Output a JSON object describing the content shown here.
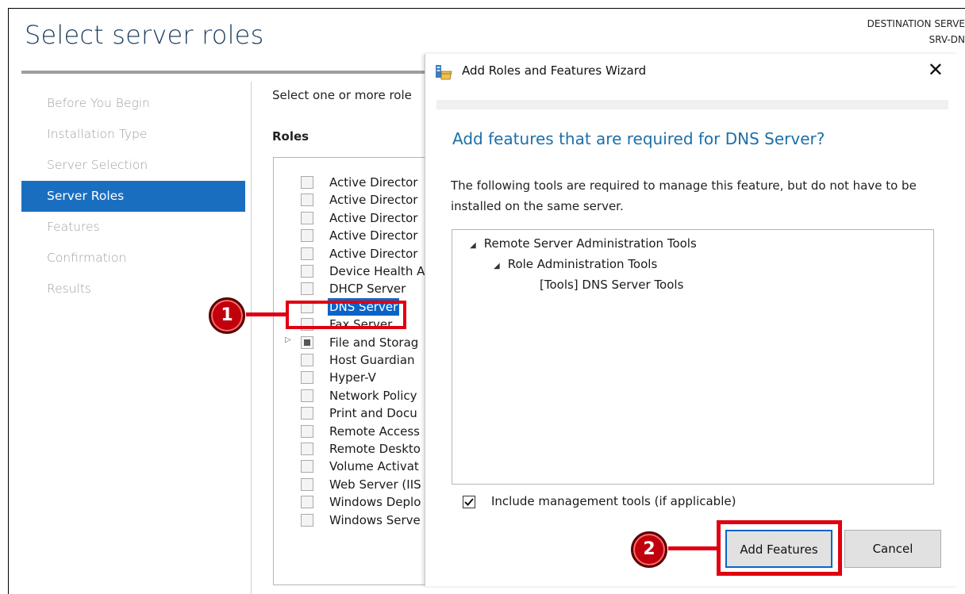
{
  "page": {
    "title": "Select server roles",
    "destination_label": "DESTINATION SERVE",
    "destination_name": "SRV-DN"
  },
  "nav": {
    "items": [
      {
        "label": "Before You Begin",
        "active": false
      },
      {
        "label": "Installation Type",
        "active": false
      },
      {
        "label": "Server Selection",
        "active": false
      },
      {
        "label": "Server Roles",
        "active": true
      },
      {
        "label": "Features",
        "active": false
      },
      {
        "label": "Confirmation",
        "active": false
      },
      {
        "label": "Results",
        "active": false
      }
    ]
  },
  "roles": {
    "intro": "Select one or more role",
    "heading": "Roles",
    "items": [
      {
        "label": "Active Director",
        "state": "unchecked",
        "expandable": false
      },
      {
        "label": "Active Director",
        "state": "unchecked",
        "expandable": false
      },
      {
        "label": "Active Director",
        "state": "unchecked",
        "expandable": false
      },
      {
        "label": "Active Director",
        "state": "unchecked",
        "expandable": false
      },
      {
        "label": "Active Director",
        "state": "unchecked",
        "expandable": false
      },
      {
        "label": "Device Health A",
        "state": "unchecked",
        "expandable": false
      },
      {
        "label": "DHCP Server",
        "state": "unchecked",
        "expandable": false
      },
      {
        "label": "DNS Server",
        "state": "unchecked",
        "expandable": false,
        "selected": true
      },
      {
        "label": "Fax Server",
        "state": "unchecked",
        "expandable": false
      },
      {
        "label": "File and Storag",
        "state": "partial",
        "expandable": true
      },
      {
        "label": "Host Guardian",
        "state": "unchecked",
        "expandable": false
      },
      {
        "label": "Hyper-V",
        "state": "unchecked",
        "expandable": false
      },
      {
        "label": "Network Policy",
        "state": "unchecked",
        "expandable": false
      },
      {
        "label": "Print and Docu",
        "state": "unchecked",
        "expandable": false
      },
      {
        "label": "Remote Access",
        "state": "unchecked",
        "expandable": false
      },
      {
        "label": "Remote Deskto",
        "state": "unchecked",
        "expandable": false
      },
      {
        "label": "Volume Activat",
        "state": "unchecked",
        "expandable": false
      },
      {
        "label": "Web Server (IIS",
        "state": "unchecked",
        "expandable": false
      },
      {
        "label": "Windows Deplo",
        "state": "unchecked",
        "expandable": false
      },
      {
        "label": "Windows Serve",
        "state": "unchecked",
        "expandable": false
      }
    ]
  },
  "dialog": {
    "title": "Add Roles and Features Wizard",
    "close_glyph": "✕",
    "heading": "Add features that are required for DNS Server?",
    "description": "The following tools are required to manage this feature, but do not have to be installed on the same server.",
    "tree": [
      {
        "label": "Remote Server Administration Tools",
        "level": 0,
        "expanded": true
      },
      {
        "label": "Role Administration Tools",
        "level": 1,
        "expanded": true
      },
      {
        "label": "[Tools] DNS Server Tools",
        "level": 2,
        "expanded": false
      }
    ],
    "include_tools_label": "Include management tools (if applicable)",
    "include_tools_checked": true,
    "add_button": "Add Features",
    "cancel_button": "Cancel"
  },
  "callouts": [
    {
      "number": "1"
    },
    {
      "number": "2"
    }
  ],
  "colors": {
    "accent": "#1a6ec0",
    "selection": "#0a64c8",
    "callout": "#e00010",
    "heading": "#1d6fa8"
  }
}
